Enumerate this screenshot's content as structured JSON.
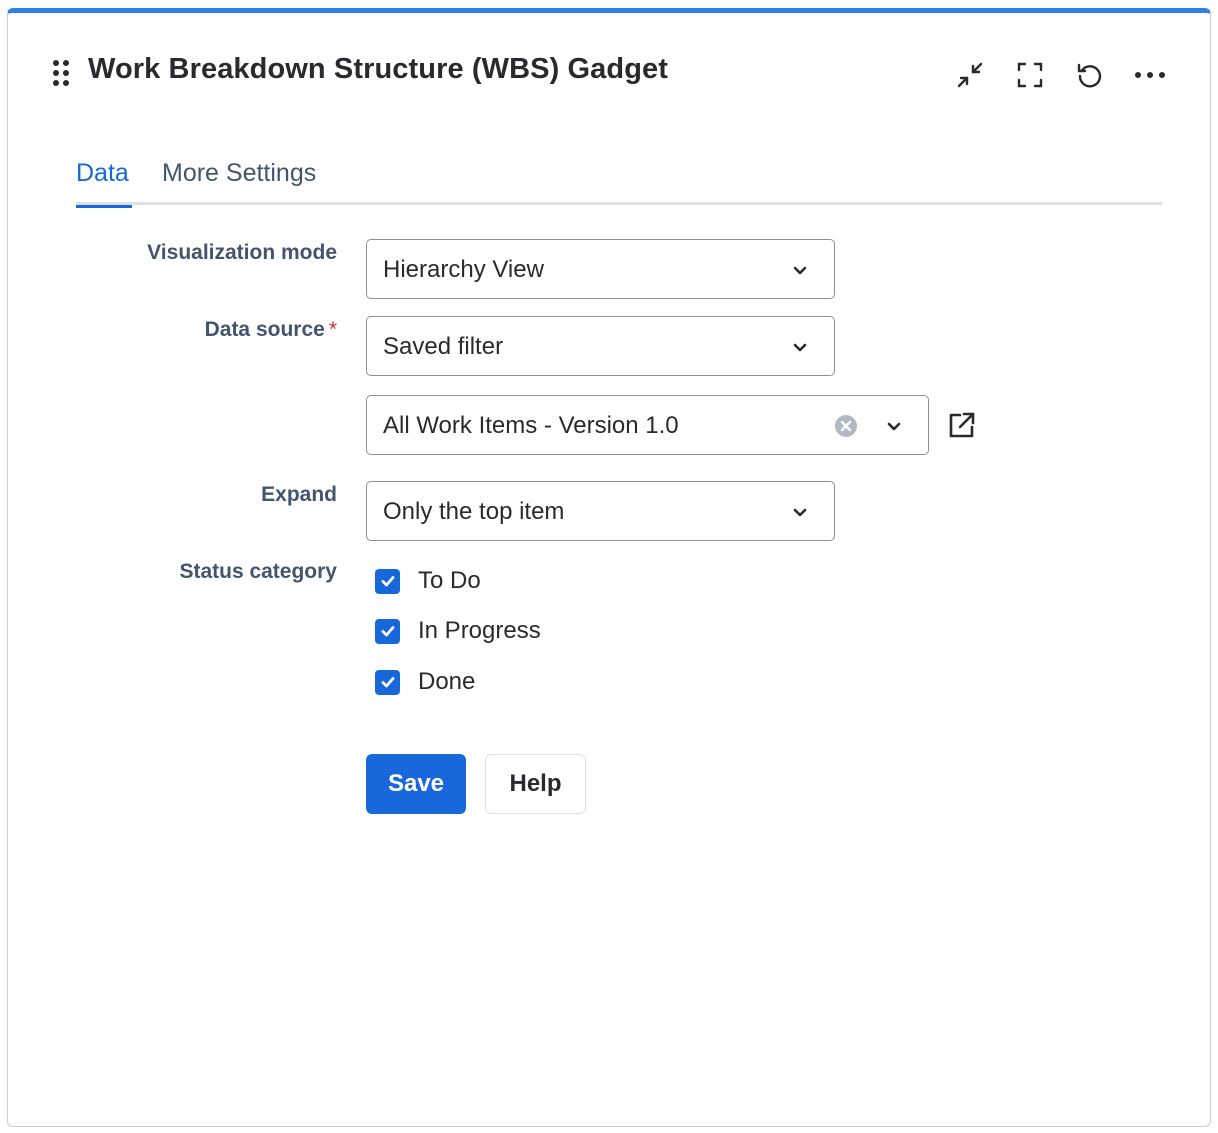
{
  "gadget": {
    "title": "Work Breakdown Structure (WBS) Gadget",
    "header_icons": [
      "drag-handle-icon",
      "minimize-icon",
      "fullscreen-icon",
      "refresh-icon",
      "more-icon"
    ],
    "accent_color": "#2f7fe6"
  },
  "tabs": [
    {
      "label": "Data",
      "active": true
    },
    {
      "label": "More Settings",
      "active": false
    }
  ],
  "form": {
    "visualization_mode": {
      "label": "Visualization mode",
      "value": "Hierarchy View"
    },
    "data_source": {
      "label": "Data source",
      "required_marker": "*",
      "value": "Saved filter"
    },
    "filter": {
      "value": "All Work Items - Version 1.0"
    },
    "expand": {
      "label": "Expand",
      "value": "Only the top item"
    },
    "status_category": {
      "label": "Status category",
      "options": [
        {
          "label": "To Do",
          "checked": true
        },
        {
          "label": "In Progress",
          "checked": true
        },
        {
          "label": "Done",
          "checked": true
        }
      ]
    }
  },
  "buttons": {
    "save_label": "Save",
    "help_label": "Help"
  },
  "colors": {
    "primary": "#1868db",
    "tab_active": "#1868db",
    "required": "#c9372c"
  }
}
